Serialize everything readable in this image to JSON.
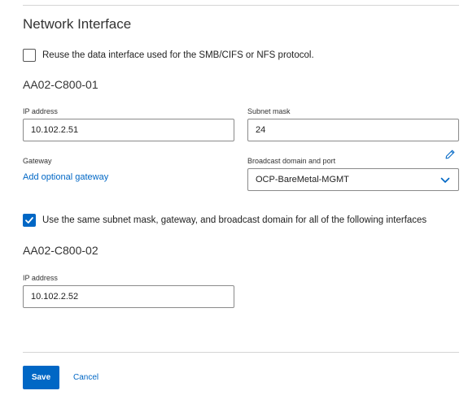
{
  "section": {
    "title": "Network Interface"
  },
  "reuse_checkbox": {
    "checked": false,
    "label": "Reuse the data interface used for the SMB/CIFS or NFS protocol."
  },
  "node1": {
    "title": "AA02-C800-01",
    "ip_label": "IP address",
    "ip_value": "10.102.2.51",
    "subnet_label": "Subnet mask",
    "subnet_value": "24",
    "gateway_label": "Gateway",
    "gateway_link": "Add optional gateway",
    "broadcast_label": "Broadcast domain and port",
    "broadcast_value": "OCP-BareMetal-MGMT"
  },
  "same_checkbox": {
    "checked": true,
    "label": "Use the same subnet mask, gateway, and broadcast domain for all of the following interfaces"
  },
  "node2": {
    "title": "AA02-C800-02",
    "ip_label": "IP address",
    "ip_value": "10.102.2.52"
  },
  "actions": {
    "save_label": "Save",
    "cancel_label": "Cancel"
  },
  "colors": {
    "accent": "#0067c5",
    "text": "#1f1f1f",
    "border": "#8a8a8a"
  },
  "icons": {
    "edit": "pencil-icon",
    "dropdown": "chevron-down-icon",
    "check": "checkmark-icon"
  }
}
